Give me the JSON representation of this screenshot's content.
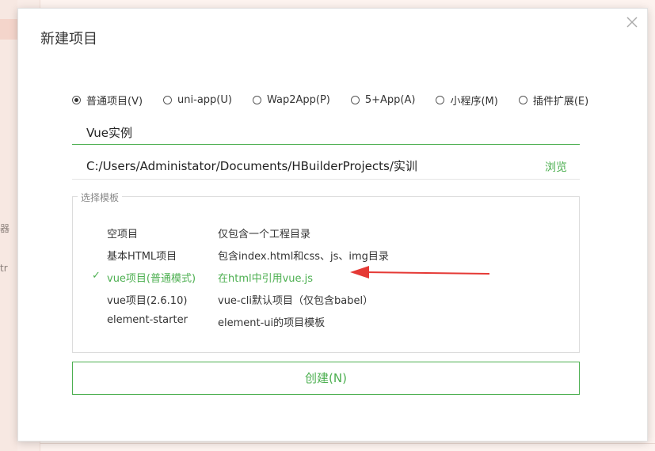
{
  "dialog": {
    "title": "新建项目"
  },
  "project_types": [
    {
      "label": "普通项目(V)",
      "checked": true
    },
    {
      "label": "uni-app(U)",
      "checked": false
    },
    {
      "label": "Wap2App(P)",
      "checked": false
    },
    {
      "label": "5+App(A)",
      "checked": false
    },
    {
      "label": "小程序(M)",
      "checked": false
    },
    {
      "label": "插件扩展(E)",
      "checked": false
    }
  ],
  "project_name": {
    "value": "Vue实例"
  },
  "project_path": {
    "value": "C:/Users/Administator/Documents/HBuilderProjects/实训",
    "browse_label": "浏览"
  },
  "templates": {
    "legend": "选择模板",
    "items": [
      {
        "name": "空项目",
        "desc": "仅包含一个工程目录",
        "selected": false
      },
      {
        "name": "基本HTML项目",
        "desc": "包含index.html和css、js、img目录",
        "selected": false
      },
      {
        "name": "vue项目(普通模式)",
        "desc": "在html中引用vue.js",
        "selected": true,
        "check": "✓"
      },
      {
        "name": "vue项目(2.6.10)",
        "desc": "vue-cli默认项目（仅包含babel）",
        "selected": false
      },
      {
        "name": "element-starter",
        "desc": "element-ui的项目模板",
        "selected": false
      }
    ]
  },
  "create_button": {
    "label": "创建(N)"
  },
  "background": {
    "frag1": "器",
    "frag2": "tr"
  },
  "colors": {
    "accent": "#4caf50",
    "arrow": "#e53935"
  }
}
